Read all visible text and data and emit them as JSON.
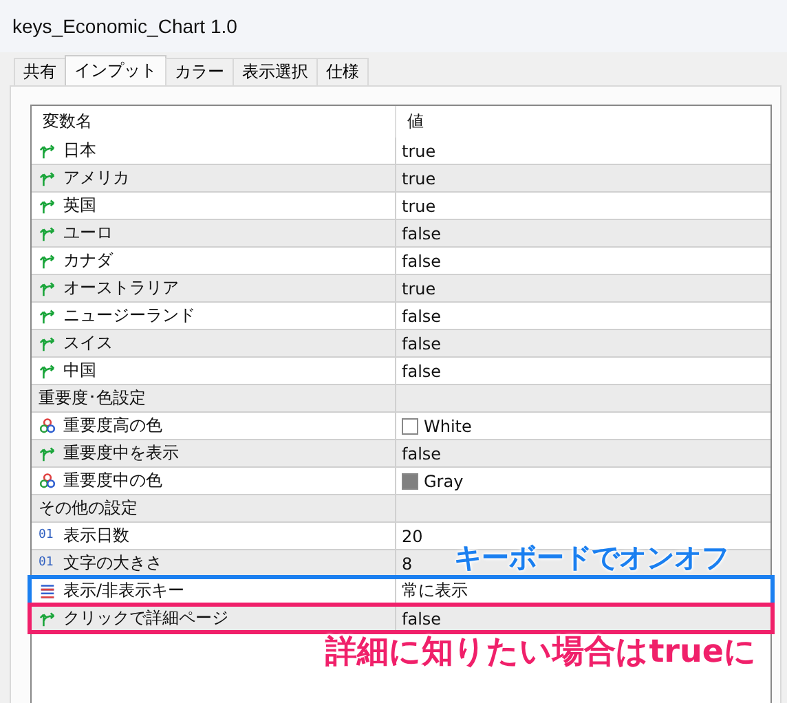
{
  "window": {
    "title": "keys_Economic_Chart 1.0"
  },
  "tabs": [
    {
      "label": "共有",
      "selected": false
    },
    {
      "label": "インプット",
      "selected": true
    },
    {
      "label": "カラー",
      "selected": false
    },
    {
      "label": "表示選択",
      "selected": false
    },
    {
      "label": "仕様",
      "selected": false
    }
  ],
  "table": {
    "columns": [
      "変数名",
      "値"
    ],
    "rows": [
      {
        "kind": "bool",
        "name": "日本",
        "value": "true"
      },
      {
        "kind": "bool",
        "name": "アメリカ",
        "value": "true"
      },
      {
        "kind": "bool",
        "name": "英国",
        "value": "true"
      },
      {
        "kind": "bool",
        "name": "ユーロ",
        "value": "false"
      },
      {
        "kind": "bool",
        "name": "カナダ",
        "value": "false"
      },
      {
        "kind": "bool",
        "name": "オーストラリア",
        "value": "true"
      },
      {
        "kind": "bool",
        "name": "ニュージーランド",
        "value": "false"
      },
      {
        "kind": "bool",
        "name": "スイス",
        "value": "false"
      },
      {
        "kind": "bool",
        "name": "中国",
        "value": "false"
      },
      {
        "kind": "group",
        "name": "重要度･色設定"
      },
      {
        "kind": "color",
        "name": "重要度高の色",
        "value": "White",
        "color": "#ffffff"
      },
      {
        "kind": "bool",
        "name": "重要度中を表示",
        "value": "false"
      },
      {
        "kind": "color",
        "name": "重要度中の色",
        "value": "Gray",
        "color": "#808080"
      },
      {
        "kind": "group",
        "name": "その他の設定"
      },
      {
        "kind": "int",
        "icon_text": "01",
        "name": "表示日数",
        "value": "20"
      },
      {
        "kind": "int",
        "icon_text": "01",
        "name": "文字の大きさ",
        "value": "8"
      },
      {
        "kind": "enum",
        "name": "表示/非表示キー",
        "value": "常に表示",
        "annotation": {
          "text": "キーボードでオンオフ",
          "color": "#1a7ff0",
          "above": true
        }
      },
      {
        "kind": "bool",
        "name": "クリックで詳細ページ",
        "value": "false",
        "annotation": {
          "text": "詳細に知りたい場合はtrueに",
          "color": "#f0206a",
          "above": false
        }
      }
    ]
  }
}
